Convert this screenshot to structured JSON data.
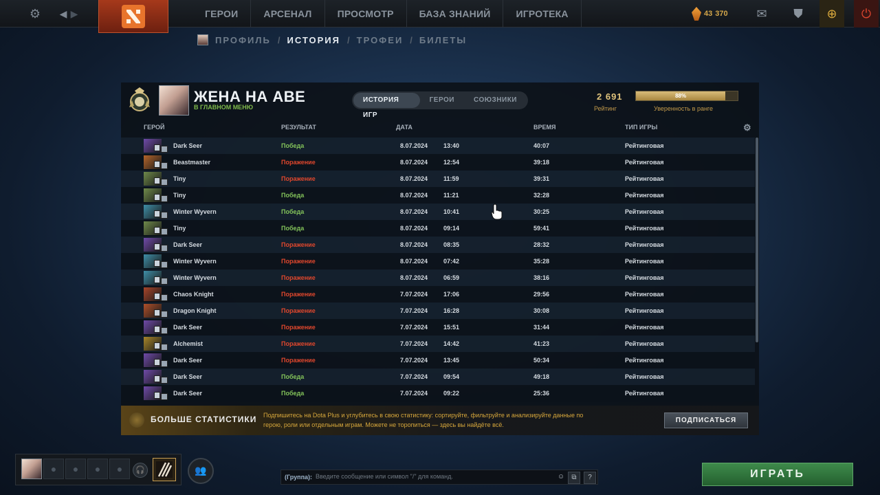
{
  "topbar": {
    "nav": [
      "ГЕРОИ",
      "АРСЕНАЛ",
      "ПРОСМОТР",
      "БАЗА ЗНАНИЙ",
      "ИГРОТЕКА"
    ],
    "currency_a": "43",
    "currency_b": "370"
  },
  "subnav": {
    "items": [
      "ПРОФИЛЬ",
      "ИСТОРИЯ",
      "ТРОФЕИ",
      "БИЛЕТЫ"
    ],
    "separator": "/"
  },
  "player": {
    "name": "ЖЕНА НА АВЕ",
    "status": "В ГЛАВНОМ МЕНЮ"
  },
  "tabs": [
    "ИСТОРИЯ ИГР",
    "ГЕРОИ",
    "СОЮЗНИКИ"
  ],
  "rating": {
    "value": "2 691",
    "label": "Рейтинг",
    "confidence": 88,
    "confidence_text": "88%",
    "confidence_label": "Уверенность в ранге"
  },
  "columns": {
    "hero": "ГЕРОЙ",
    "result": "РЕЗУЛЬТАТ",
    "date": "ДАТА",
    "duration": "ВРЕМЯ",
    "mode": "ТИП ИГРЫ"
  },
  "matches": [
    {
      "hero": "Dark Seer",
      "result": "Победа",
      "win": true,
      "date": "8.07.2024",
      "time": "13:40",
      "duration": "40:07",
      "mode": "Рейтинговая"
    },
    {
      "hero": "Beastmaster",
      "result": "Поражение",
      "win": false,
      "date": "8.07.2024",
      "time": "12:54",
      "duration": "39:18",
      "mode": "Рейтинговая"
    },
    {
      "hero": "Tiny",
      "result": "Поражение",
      "win": false,
      "date": "8.07.2024",
      "time": "11:59",
      "duration": "39:31",
      "mode": "Рейтинговая"
    },
    {
      "hero": "Tiny",
      "result": "Победа",
      "win": true,
      "date": "8.07.2024",
      "time": "11:21",
      "duration": "32:28",
      "mode": "Рейтинговая"
    },
    {
      "hero": "Winter Wyvern",
      "result": "Победа",
      "win": true,
      "date": "8.07.2024",
      "time": "10:41",
      "duration": "30:25",
      "mode": "Рейтинговая"
    },
    {
      "hero": "Tiny",
      "result": "Победа",
      "win": true,
      "date": "8.07.2024",
      "time": "09:14",
      "duration": "59:41",
      "mode": "Рейтинговая"
    },
    {
      "hero": "Dark Seer",
      "result": "Поражение",
      "win": false,
      "date": "8.07.2024",
      "time": "08:35",
      "duration": "28:32",
      "mode": "Рейтинговая"
    },
    {
      "hero": "Winter Wyvern",
      "result": "Поражение",
      "win": false,
      "date": "8.07.2024",
      "time": "07:42",
      "duration": "35:28",
      "mode": "Рейтинговая"
    },
    {
      "hero": "Winter Wyvern",
      "result": "Поражение",
      "win": false,
      "date": "8.07.2024",
      "time": "06:59",
      "duration": "38:16",
      "mode": "Рейтинговая"
    },
    {
      "hero": "Chaos Knight",
      "result": "Поражение",
      "win": false,
      "date": "7.07.2024",
      "time": "17:06",
      "duration": "29:56",
      "mode": "Рейтинговая"
    },
    {
      "hero": "Dragon Knight",
      "result": "Поражение",
      "win": false,
      "date": "7.07.2024",
      "time": "16:28",
      "duration": "30:08",
      "mode": "Рейтинговая"
    },
    {
      "hero": "Dark Seer",
      "result": "Поражение",
      "win": false,
      "date": "7.07.2024",
      "time": "15:51",
      "duration": "31:44",
      "mode": "Рейтинговая"
    },
    {
      "hero": "Alchemist",
      "result": "Поражение",
      "win": false,
      "date": "7.07.2024",
      "time": "14:42",
      "duration": "41:23",
      "mode": "Рейтинговая"
    },
    {
      "hero": "Dark Seer",
      "result": "Поражение",
      "win": false,
      "date": "7.07.2024",
      "time": "13:45",
      "duration": "50:34",
      "mode": "Рейтинговая"
    },
    {
      "hero": "Dark Seer",
      "result": "Победа",
      "win": true,
      "date": "7.07.2024",
      "time": "09:54",
      "duration": "49:18",
      "mode": "Рейтинговая"
    },
    {
      "hero": "Dark Seer",
      "result": "Победа",
      "win": true,
      "date": "7.07.2024",
      "time": "09:22",
      "duration": "25:36",
      "mode": "Рейтинговая"
    }
  ],
  "hero_colors": {
    "Dark Seer": "#6f4aa8",
    "Beastmaster": "#b5652a",
    "Tiny": "#6f8a4a",
    "Winter Wyvern": "#3f8fa8",
    "Chaos Knight": "#a8452a",
    "Dragon Knight": "#b0502a",
    "Alchemist": "#a8862a"
  },
  "plus": {
    "title": "БОЛЬШЕ СТАТИСТИКИ",
    "text": "Подпишитесь на Dota Plus и углубитесь в свою статистику: сортируйте, фильтруйте и анализируйте данные по герою, роли или отдельным играм. Можете не торопиться — здесь вы найдёте всё.",
    "button": "ПОДПИСАТЬСЯ"
  },
  "chat": {
    "label": "(Группа):",
    "placeholder": "Введите сообщение или символ \"/\" для команд."
  },
  "play_button": "ИГРАТЬ",
  "colors": {
    "win": "#83c35a",
    "loss": "#e0472d",
    "gold": "#d8a83c",
    "play": "#2f7a3d"
  }
}
